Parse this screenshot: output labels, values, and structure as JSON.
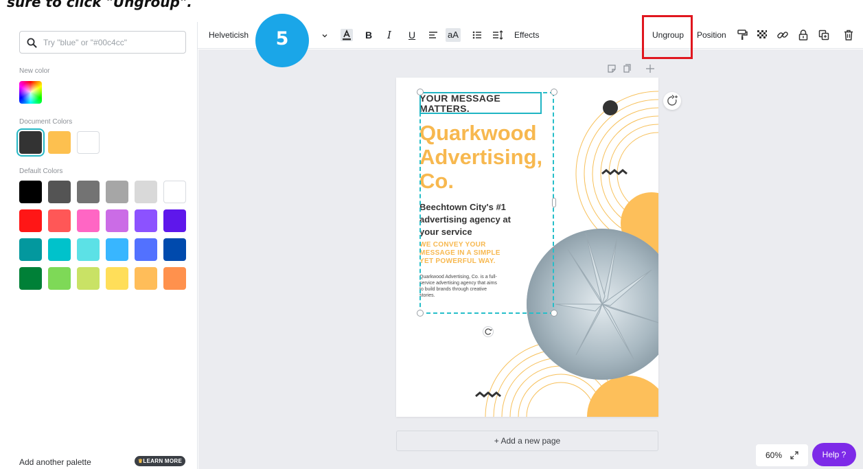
{
  "caption": {
    "text": "sure to click \"Ungroup\"."
  },
  "step_badge": {
    "number": "5"
  },
  "left_panel": {
    "search_placeholder": "Try \"blue\" or \"#00c4cc\"",
    "new_color_label": "New color",
    "document_colors_label": "Document Colors",
    "document_colors": [
      "#333333",
      "#FDC04F",
      "#FFFFFF"
    ],
    "default_colors_label": "Default Colors",
    "default_colors": [
      [
        "#000000",
        "#545454",
        "#737373",
        "#a6a6a6",
        "#d9d9d9",
        "#ffffff"
      ],
      [
        "#ff1616",
        "#ff5757",
        "#ff66c4",
        "#cb6ce6",
        "#8c52ff",
        "#5e17eb"
      ],
      [
        "#03989e",
        "#00c2cb",
        "#5ce1e6",
        "#38b6ff",
        "#5271ff",
        "#004aad"
      ],
      [
        "#008037",
        "#7ed957",
        "#c9e265",
        "#ffde59",
        "#ffbd59",
        "#ff914d"
      ]
    ],
    "add_palette_label": "Add another palette",
    "learn_more_label": "LEARN MORE"
  },
  "toolbar": {
    "font_name": "Helveticish",
    "effects_label": "Effects",
    "ungroup_label": "Ungroup",
    "position_label": "Position"
  },
  "page": {
    "tagline": "YOUR MESSAGE MATTERS.",
    "title": "Quarkwood Advertising, Co.",
    "subtitle": "Beechtown City's #1 advertising agency at your service",
    "slogan": "WE CONVEY YOUR MESSAGE IN A SIMPLE YET POWERFUL WAY.",
    "body": "Quarkwood Advertising, Co. is a full-service advertising agency that aims to build brands through creative stories."
  },
  "add_page_label": "+ Add a new page",
  "zoom_label": "60%",
  "help_label": "Help ?",
  "colors": {
    "accent": "#f7b84f",
    "selection": "#26bec9",
    "help": "#7d2ae8",
    "badge": "#1aa6e8",
    "highlight": "#e0161e"
  }
}
